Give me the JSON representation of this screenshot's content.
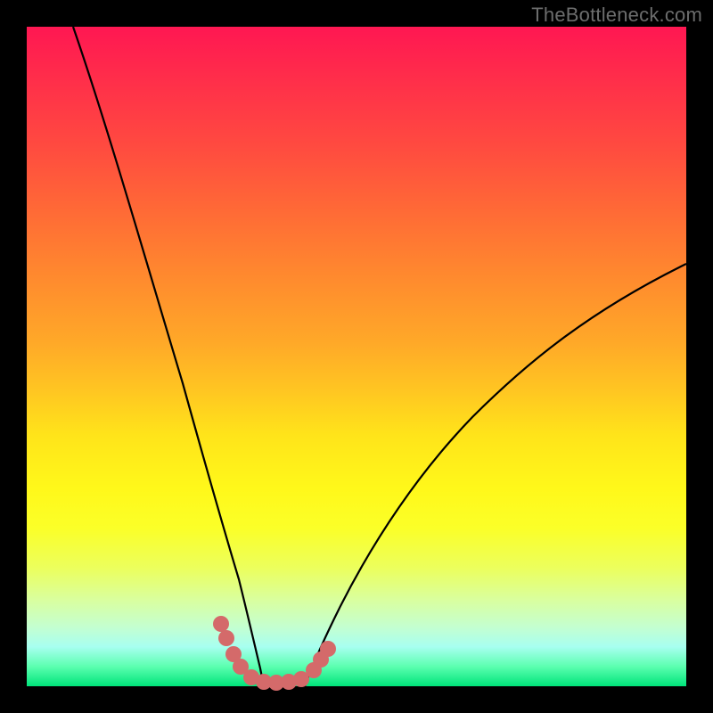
{
  "watermark": "TheBottleneck.com",
  "chart_data": {
    "type": "line",
    "title": "",
    "xlabel": "",
    "ylabel": "",
    "xlim": [
      0,
      100
    ],
    "ylim": [
      0,
      100
    ],
    "series": [
      {
        "name": "left-curve",
        "x": [
          7,
          10,
          15,
          20,
          25,
          27,
          29,
          31,
          32.5,
          34
        ],
        "y": [
          100,
          82,
          58,
          38,
          20,
          13,
          8,
          4,
          2,
          0
        ]
      },
      {
        "name": "right-curve",
        "x": [
          42,
          44,
          47,
          52,
          60,
          70,
          80,
          90,
          100
        ],
        "y": [
          0,
          2,
          6,
          13,
          24,
          37,
          48,
          57,
          64
        ]
      },
      {
        "name": "dotted-segment",
        "x": [
          29,
          30,
          31,
          32,
          34,
          36,
          38,
          40,
          42,
          43.5,
          44.5,
          45.5
        ],
        "y": [
          9,
          7,
          5,
          3.5,
          1,
          0.5,
          0.5,
          0.7,
          1.2,
          2.5,
          4,
          5.5
        ]
      }
    ],
    "colors": {
      "curve": "#000000",
      "dots": "#d46a6a",
      "gradient_top": "#ff1752",
      "gradient_bottom": "#00e47a"
    }
  }
}
